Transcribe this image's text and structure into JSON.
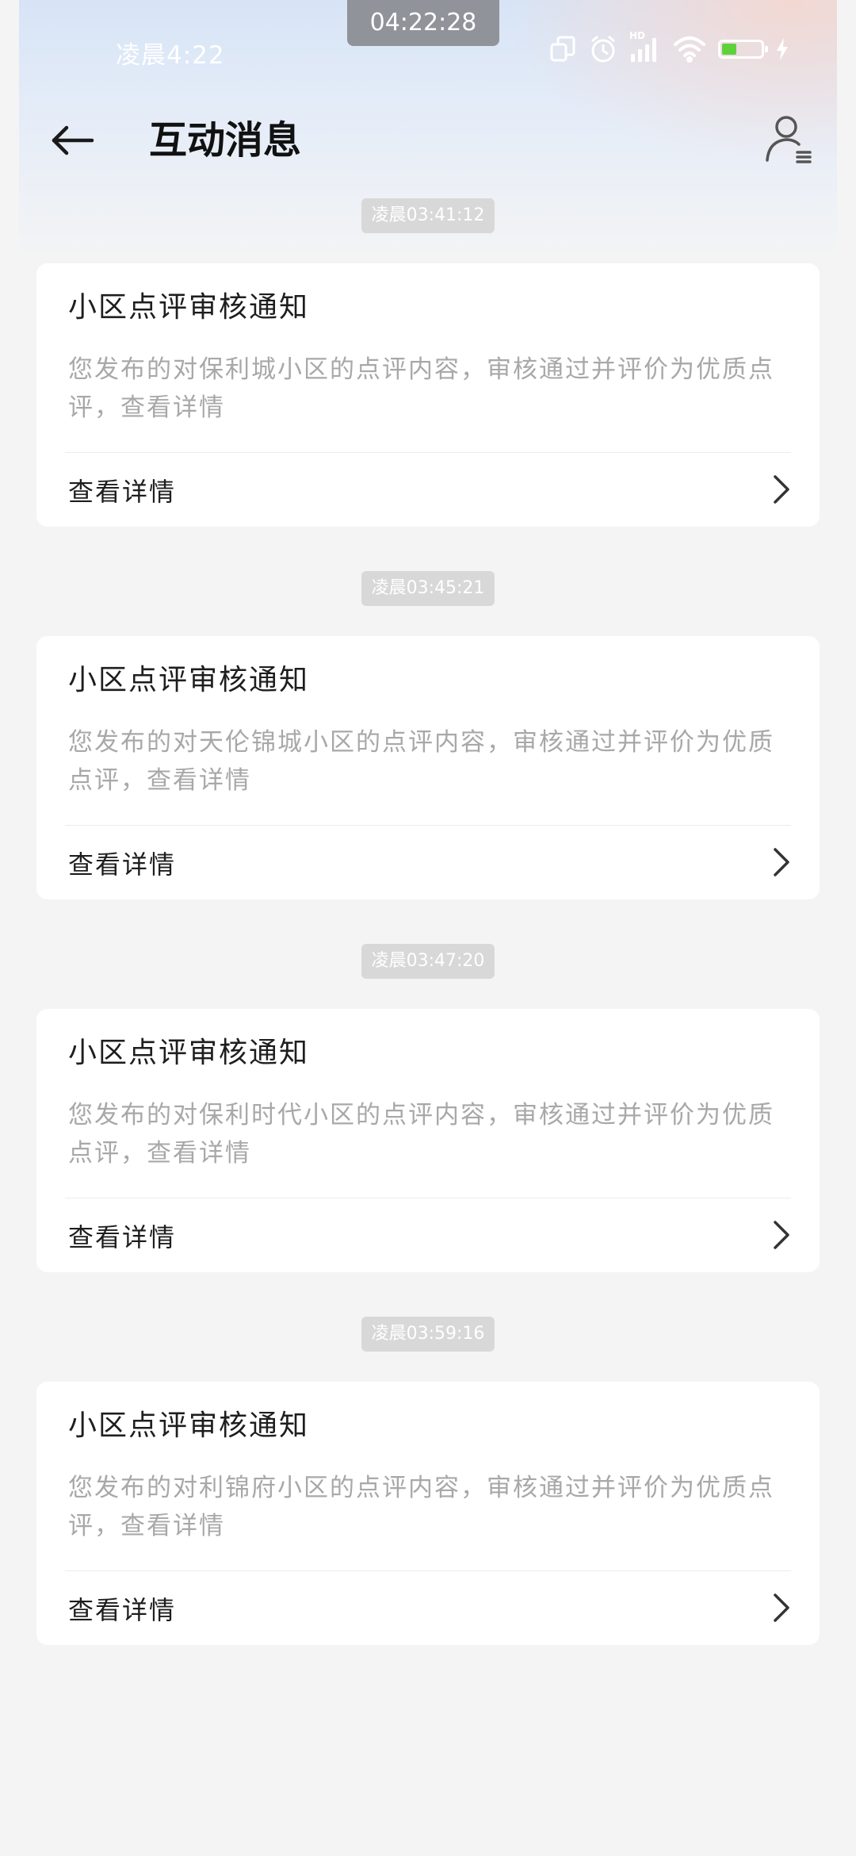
{
  "status_bar": {
    "time": "凌晨4:22",
    "clock": "04:22:28",
    "network_badge": "HD",
    "battery_level": "37",
    "battery_color": "#5fd23a"
  },
  "header": {
    "title": "互动消息",
    "back_icon": "arrow-left-icon",
    "user_icon": "user-list-icon"
  },
  "messages": [
    {
      "timestamp": "凌晨03:41:12",
      "title": "小区点评审核通知",
      "body": "您发布的对保利城小区的点评内容，审核通过并评价为优质点评，查看详情",
      "action": "查看详情"
    },
    {
      "timestamp": "凌晨03:45:21",
      "title": "小区点评审核通知",
      "body": "您发布的对天伦锦城小区的点评内容，审核通过并评价为优质点评，查看详情",
      "action": "查看详情"
    },
    {
      "timestamp": "凌晨03:47:20",
      "title": "小区点评审核通知",
      "body": "您发布的对保利时代小区的点评内容，审核通过并评价为优质点评，查看详情",
      "action": "查看详情"
    },
    {
      "timestamp": "凌晨03:59:16",
      "title": "小区点评审核通知",
      "body": "您发布的对利锦府小区的点评内容，审核通过并评价为优质点评，查看详情",
      "action": "查看详情"
    }
  ]
}
